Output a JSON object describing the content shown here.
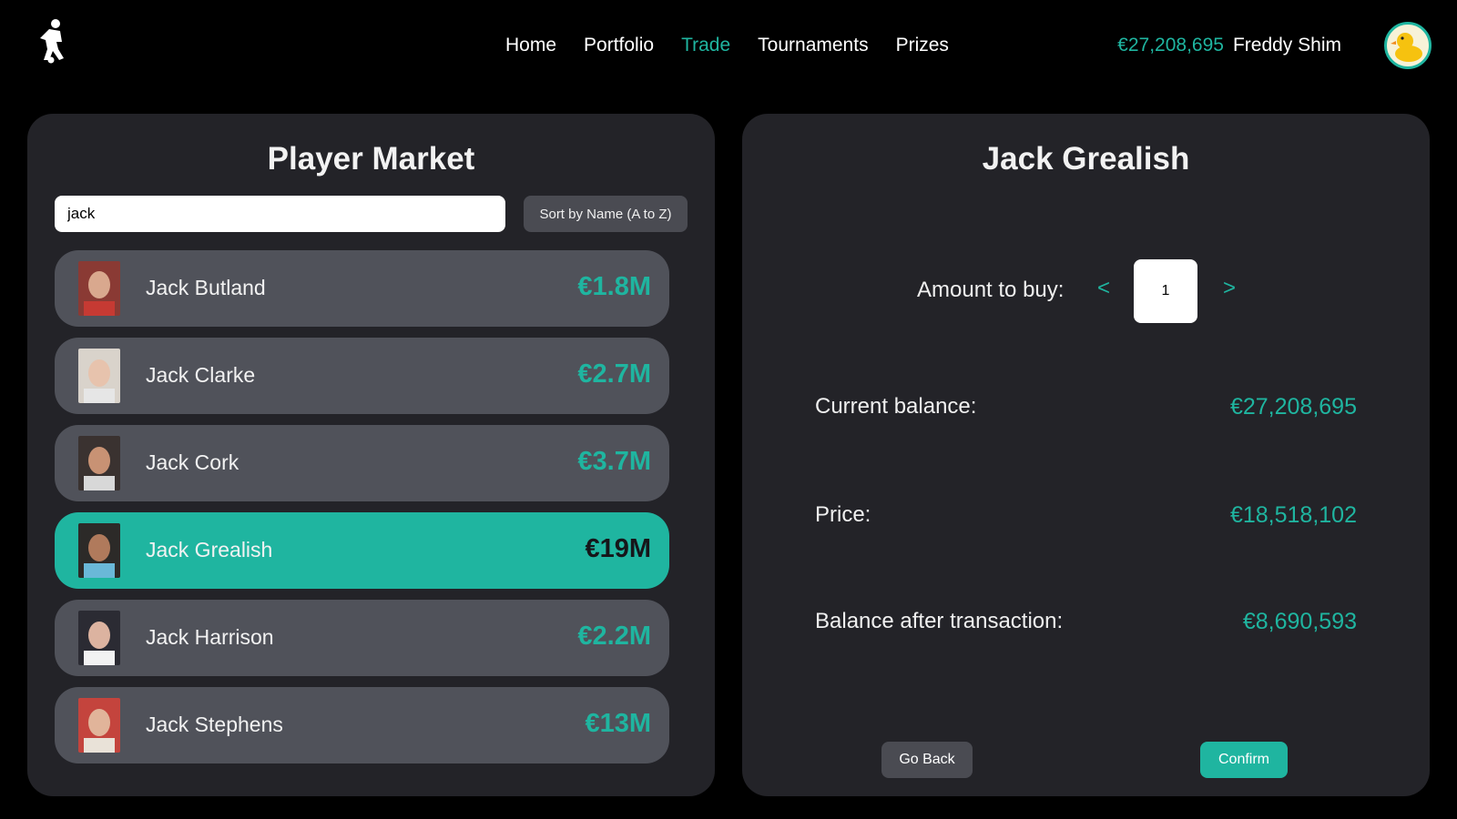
{
  "nav": {
    "items": [
      {
        "label": "Home"
      },
      {
        "label": "Portfolio"
      },
      {
        "label": "Trade"
      },
      {
        "label": "Tournaments"
      },
      {
        "label": "Prizes"
      }
    ],
    "active": "Trade"
  },
  "user": {
    "balance": "€27,208,695",
    "name": "Freddy Shim",
    "avatar_icon": "duck-avatar"
  },
  "market": {
    "title": "Player Market",
    "search_value": "jack",
    "sort_label": "Sort by Name (A to Z)",
    "players": [
      {
        "name": "Jack Butland",
        "price": "€1.8M"
      },
      {
        "name": "Jack Clarke",
        "price": "€2.7M"
      },
      {
        "name": "Jack Cork",
        "price": "€3.7M"
      },
      {
        "name": "Jack Grealish",
        "price": "€19M"
      },
      {
        "name": "Jack Harrison",
        "price": "€2.2M"
      },
      {
        "name": "Jack Stephens",
        "price": "€13M"
      }
    ],
    "selected_index": 3
  },
  "trade": {
    "player_name": "Jack Grealish",
    "amount_label": "Amount to buy:",
    "decrement": "<",
    "increment": ">",
    "amount_value": "1",
    "current_balance_label": "Current balance:",
    "current_balance": "€27,208,695",
    "price_label": "Price:",
    "price": "€18,518,102",
    "after_label": "Balance after transaction:",
    "after_balance": "€8,690,593",
    "back_label": "Go Back",
    "confirm_label": "Confirm"
  },
  "colors": {
    "accent": "#1fb5a0",
    "panel": "#232328",
    "row": "#50525a"
  }
}
